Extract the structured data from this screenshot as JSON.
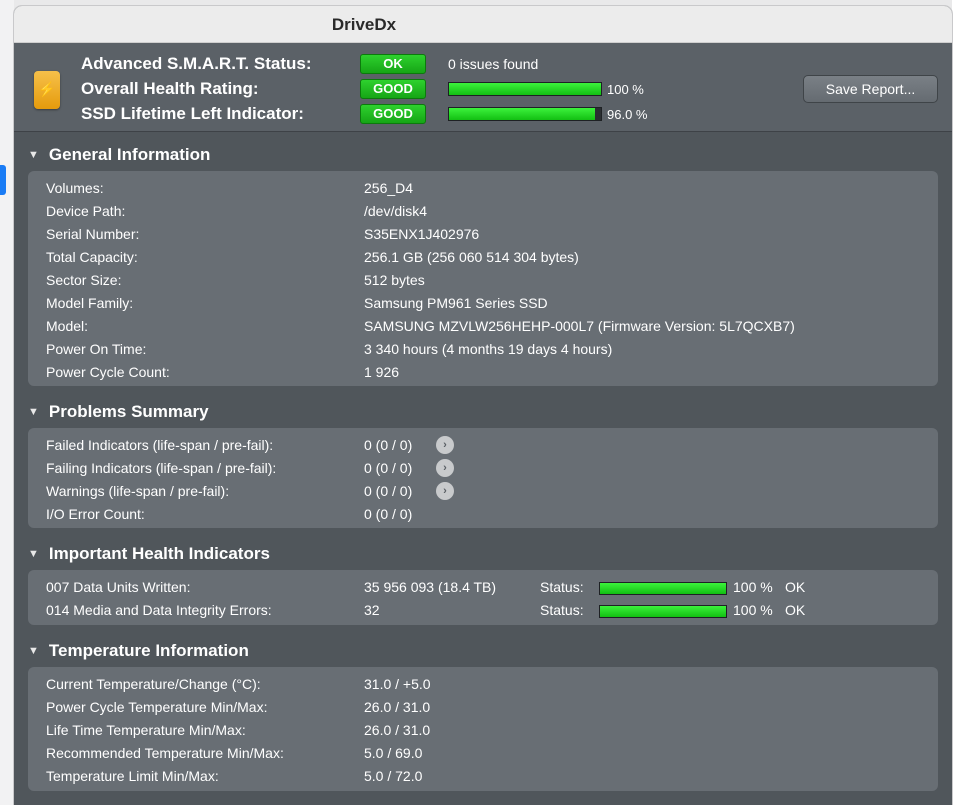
{
  "window": {
    "title": "DriveDx"
  },
  "header": {
    "smart_label": "Advanced S.M.A.R.T. Status:",
    "smart_badge": "OK",
    "smart_text": "0 issues found",
    "health_label": "Overall Health Rating:",
    "health_badge": "GOOD",
    "health_value": 1.0,
    "health_pct": "100 %",
    "ssd_label": "SSD Lifetime Left Indicator:",
    "ssd_badge": "GOOD",
    "ssd_value": 0.96,
    "ssd_pct": "96.0 %",
    "save_button": "Save Report...",
    "badge_color": "#1fbf1f",
    "bar_color": "#22e022"
  },
  "general": {
    "title": "General Information",
    "rows": [
      {
        "key": "Volumes:",
        "value": "256_D4"
      },
      {
        "key": "Device Path:",
        "value": "/dev/disk4"
      },
      {
        "key": "Serial Number:",
        "value": "S35ENX1J402976"
      },
      {
        "key": "Total Capacity:",
        "value": "256.1 GB (256 060 514 304 bytes)"
      },
      {
        "key": "Sector Size:",
        "value": "512 bytes"
      },
      {
        "key": "Model Family:",
        "value": "Samsung PM961 Series SSD"
      },
      {
        "key": "Model:",
        "value": "SAMSUNG MZVLW256HEHP-000L7  (Firmware Version: 5L7QCXB7)"
      },
      {
        "key": "Power On Time:",
        "value": "3 340 hours (4 months 19 days 4 hours)"
      },
      {
        "key": "Power Cycle Count:",
        "value": "1 926"
      }
    ]
  },
  "problems": {
    "title": "Problems Summary",
    "rows": [
      {
        "key": "Failed Indicators (life-span / pre-fail):",
        "value": "0 (0 / 0)"
      },
      {
        "key": "Failing Indicators (life-span / pre-fail):",
        "value": "0 (0 / 0)"
      },
      {
        "key": "Warnings (life-span / pre-fail):",
        "value": "0 (0 / 0)"
      },
      {
        "key": "I/O Error Count:",
        "value": "0 (0 / 0)"
      }
    ]
  },
  "health": {
    "title": "Important Health Indicators",
    "rows": [
      {
        "key": "007  Data Units Written:",
        "value": "35 956 093 (18.4 TB)",
        "status_label": "Status:",
        "level": 1.0,
        "pct": "100 %",
        "state": "OK"
      },
      {
        "key": "014  Media and Data Integrity Errors:",
        "value": "32",
        "status_label": "Status:",
        "level": 1.0,
        "pct": "100 %",
        "state": "OK"
      }
    ]
  },
  "temperature": {
    "title": "Temperature Information",
    "rows": [
      {
        "key": "Current Temperature/Change (°C):",
        "value": "31.0 / +5.0"
      },
      {
        "key": "Power Cycle Temperature Min/Max:",
        "value": "26.0 / 31.0"
      },
      {
        "key": "Life Time Temperature Min/Max:",
        "value": "26.0 / 31.0"
      },
      {
        "key": "Recommended Temperature Min/Max:",
        "value": "5.0   / 69.0"
      },
      {
        "key": "Temperature Limit Min/Max:",
        "value": "5.0   / 72.0"
      }
    ]
  }
}
